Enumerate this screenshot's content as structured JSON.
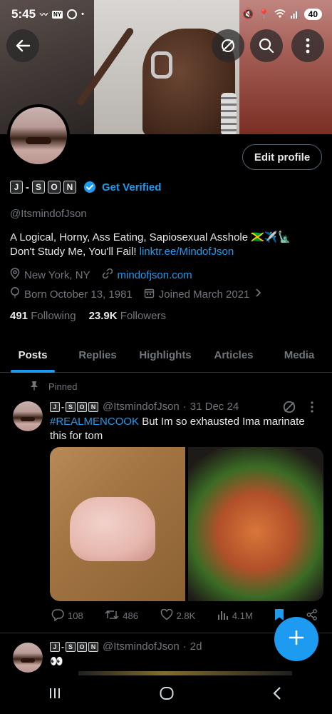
{
  "status_bar": {
    "time": "5:45",
    "battery": "40"
  },
  "colors": {
    "accent": "#1d9bf0",
    "background": "#000000",
    "muted_text": "#71767b",
    "primary_text": "#e7e9ea"
  },
  "header": {
    "back_icon": "arrow-left-icon",
    "grok_icon": "slash-circle-icon",
    "search_icon": "search-icon",
    "more_icon": "more-vertical-icon"
  },
  "profile": {
    "edit_button": "Edit profile",
    "name_glyphs": [
      "J",
      "S",
      "O",
      "N"
    ],
    "name_dash": "-",
    "get_verified": "Get Verified",
    "handle": "@ItsmindofJson",
    "bio_line1": "A Logical,  Horny, Ass Eating, Sapiosexual Asshole 🇯🇲✈️🗽",
    "bio_line2_text": "Don't Study Me,  You'll Fail! ",
    "bio_link": "linktr.ee/MindofJson",
    "location": "New York, NY",
    "website": "mindofjson.com",
    "born": "Born October 13, 1981",
    "joined": "Joined March 2021",
    "following_count": "491",
    "following_label": "Following",
    "followers_count": "23.9K",
    "followers_label": "Followers"
  },
  "tabs": [
    {
      "label": "Posts",
      "active": true
    },
    {
      "label": "Replies",
      "active": false
    },
    {
      "label": "Highlights",
      "active": false
    },
    {
      "label": "Articles",
      "active": false
    },
    {
      "label": "Media",
      "active": false
    }
  ],
  "pinned_label": "Pinned",
  "posts": [
    {
      "handle": "@ItsmindofJson",
      "separator": "·",
      "date": "31 Dec 24",
      "hashtag": "#REALMENCOOK",
      "text": " But Im so exhausted Ima marinate this for tom",
      "replies": "108",
      "reposts": "486",
      "likes": "2.8K",
      "views": "4.1M"
    },
    {
      "handle": "@ItsmindofJson",
      "separator": "·",
      "date": "2d",
      "text": "👀"
    }
  ]
}
